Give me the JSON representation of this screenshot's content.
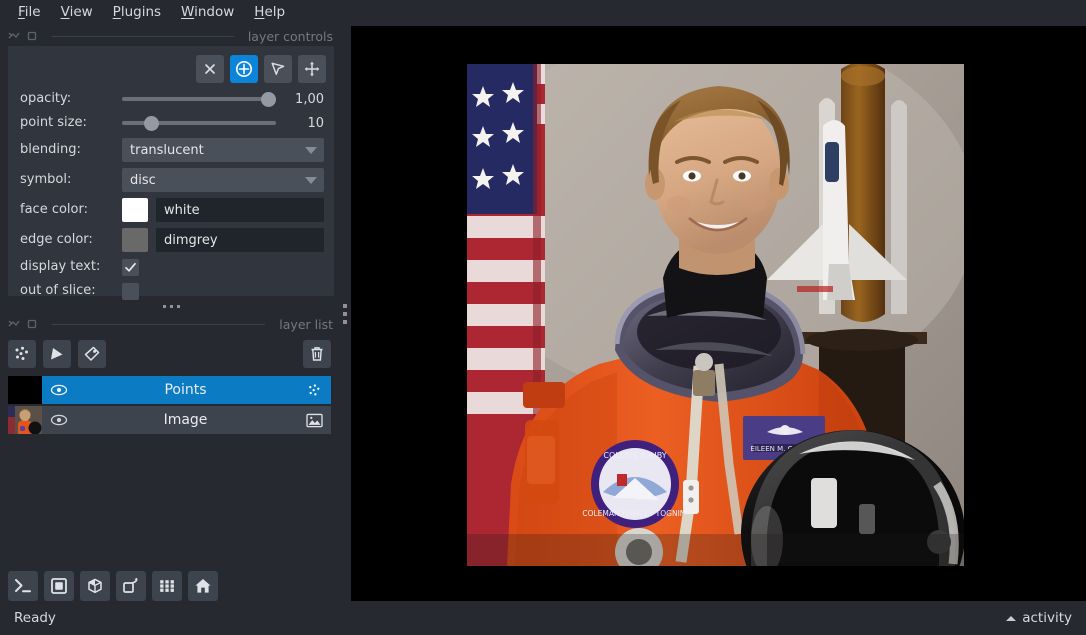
{
  "app": {
    "status_text": "Ready",
    "activity_label": "activity",
    "accent_color": "#0b84d9",
    "panel_bg": "#30353e",
    "window_bg": "#262930"
  },
  "menubar": {
    "items": [
      {
        "label": "File",
        "mnemonic": "F"
      },
      {
        "label": "View",
        "mnemonic": "V"
      },
      {
        "label": "Plugins",
        "mnemonic": "P"
      },
      {
        "label": "Window",
        "mnemonic": "W"
      },
      {
        "label": "Help",
        "mnemonic": "H"
      }
    ]
  },
  "layer_controls": {
    "dock_title": "layer controls",
    "tools": [
      {
        "name": "delete-selected-points",
        "icon": "close-icon",
        "active": false
      },
      {
        "name": "add-points",
        "icon": "add-circle-icon",
        "active": true
      },
      {
        "name": "select-points",
        "icon": "cursor-arrow-icon",
        "active": false
      },
      {
        "name": "pan-zoom",
        "icon": "move-icon",
        "active": false
      }
    ],
    "opacity": {
      "label": "opacity:",
      "value": "1,00",
      "percent": 100
    },
    "point_size": {
      "label": "point size:",
      "value": "10",
      "percent": 18
    },
    "blending": {
      "label": "blending:",
      "value": "translucent"
    },
    "symbol": {
      "label": "symbol:",
      "value": "disc"
    },
    "face_color": {
      "label": "face color:",
      "value": "white",
      "hex": "#ffffff"
    },
    "edge_color": {
      "label": "edge color:",
      "value": "dimgrey",
      "hex": "#696969"
    },
    "display_text": {
      "label": "display text:",
      "checked": true
    },
    "out_of_slice": {
      "label": "out of slice:",
      "checked": false
    }
  },
  "layer_list": {
    "dock_title": "layer list",
    "buttons": [
      {
        "name": "new-points-layer",
        "icon": "points-icon"
      },
      {
        "name": "new-shapes-layer",
        "icon": "shapes-icon"
      },
      {
        "name": "new-labels-layer",
        "icon": "labels-tag-icon"
      },
      {
        "name": "delete-layer",
        "icon": "trash-icon"
      }
    ],
    "layers": [
      {
        "name": "Points",
        "selected": true,
        "visible": true,
        "type_icon": "points-icon",
        "thumbnail": "black"
      },
      {
        "name": "Image",
        "selected": false,
        "visible": true,
        "type_icon": "image-icon",
        "thumbnail": "astronaut"
      }
    ]
  },
  "viewer_buttons": [
    {
      "name": "console-button",
      "icon": "terminal-icon"
    },
    {
      "name": "ndisplay-toggle-button",
      "icon": "square-2d-icon"
    },
    {
      "name": "ndisplay-3d-button",
      "icon": "cube-3d-icon"
    },
    {
      "name": "roll-dims-button",
      "icon": "roll-icon"
    },
    {
      "name": "grid-view-button",
      "icon": "grid-icon"
    },
    {
      "name": "reset-view-button",
      "icon": "home-icon"
    }
  ]
}
